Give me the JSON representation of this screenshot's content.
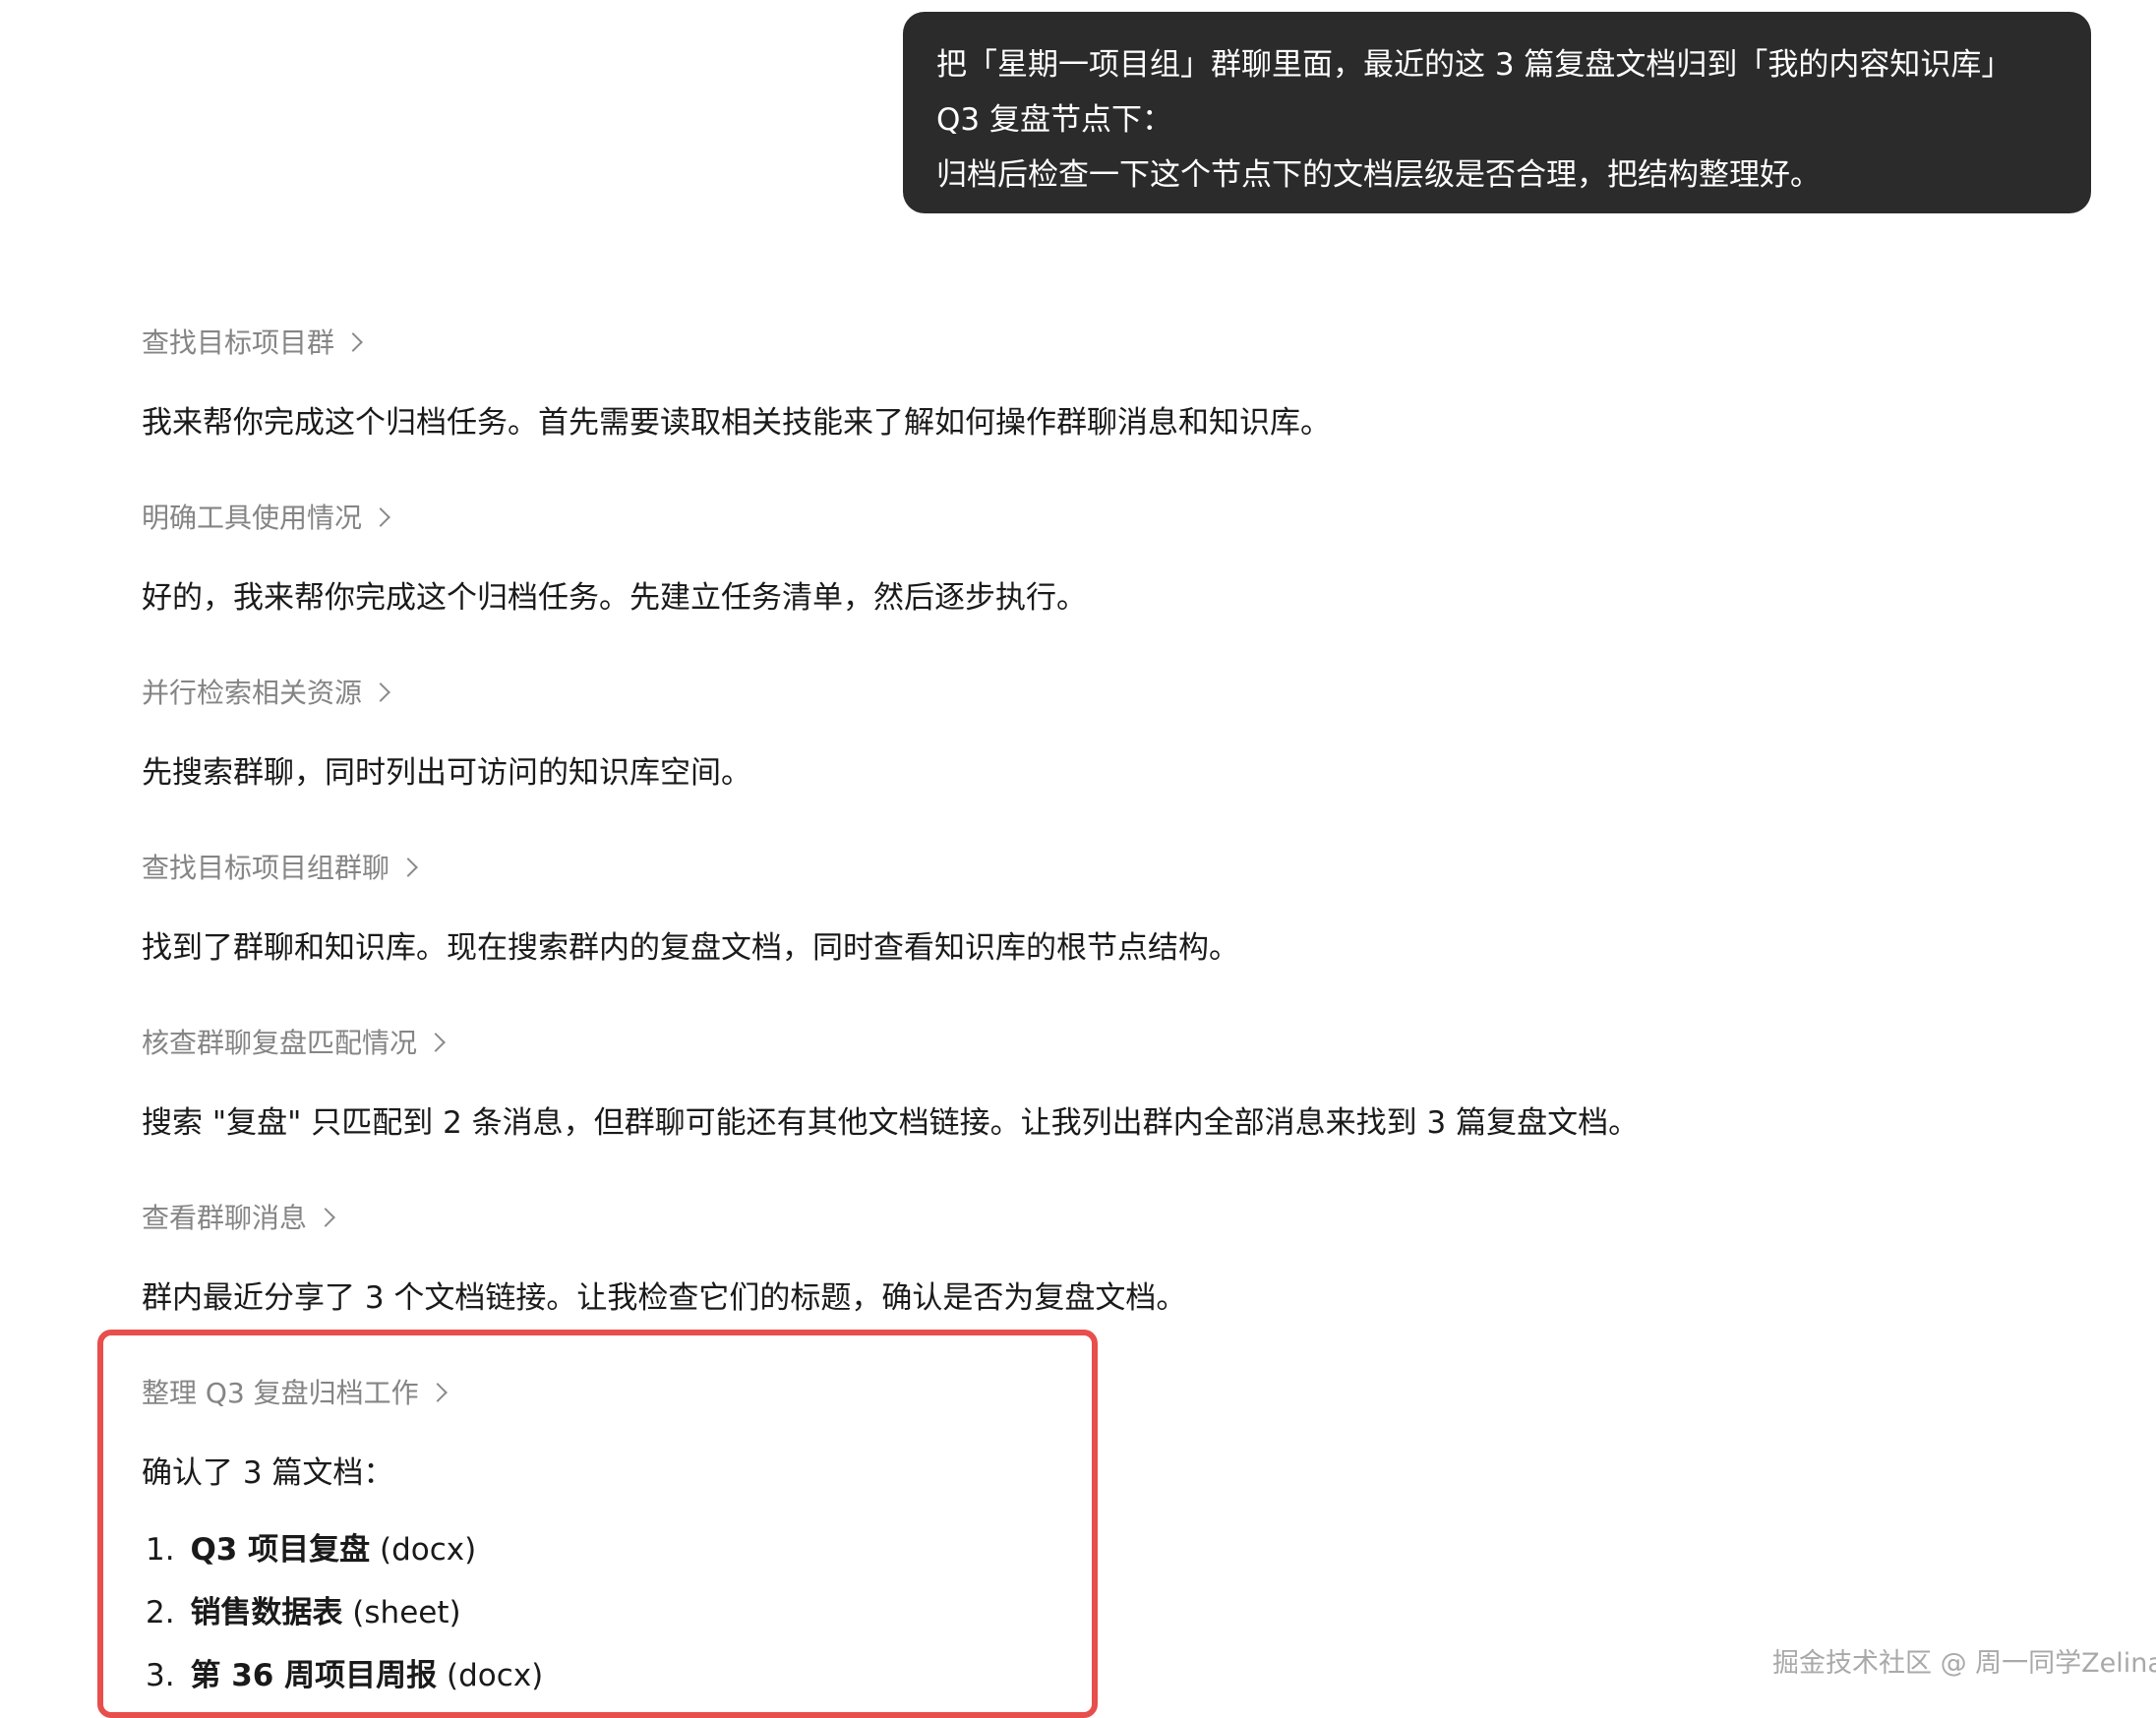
{
  "user_message": {
    "lines": [
      "把「星期一项目组」群聊里面，最近的这 3 篇复盘文档归到「我的内容知识库」",
      "Q3 复盘节点下：",
      "归档后检查一下这个节点下的文档层级是否合理，把结构整理好。"
    ]
  },
  "conversation": [
    {
      "step": "查找目标项目群",
      "reply": "我来帮你完成这个归档任务。首先需要读取相关技能来了解如何操作群聊消息和知识库。"
    },
    {
      "step": "明确工具使用情况",
      "reply": "好的，我来帮你完成这个归档任务。先建立任务清单，然后逐步执行。"
    },
    {
      "step": "并行检索相关资源",
      "reply": "先搜索群聊，同时列出可访问的知识库空间。"
    },
    {
      "step": "查找目标项目组群聊",
      "reply": "找到了群聊和知识库。现在搜索群内的复盘文档，同时查看知识库的根节点结构。"
    },
    {
      "step": "核查群聊复盘匹配情况",
      "reply": "搜索 \"复盘\" 只匹配到 2 条消息，但群聊可能还有其他文档链接。让我列出群内全部消息来找到 3 篇复盘文档。"
    },
    {
      "step": "查看群聊消息",
      "reply": "群内最近分享了 3 个文档链接。让我检查它们的标题，确认是否为复盘文档。"
    },
    {
      "step": "整理 Q3 复盘归档工作",
      "reply": "确认了 3 篇文档："
    }
  ],
  "documents": [
    {
      "num": "1.",
      "title": "Q3 项目复盘",
      "type": "(docx)"
    },
    {
      "num": "2.",
      "title": "销售数据表",
      "type": "(sheet)"
    },
    {
      "num": "3.",
      "title": "第 36 周项目周报",
      "type": "(docx)"
    }
  ],
  "watermark": "掘金技术社区 @ 周一同学Zelina",
  "colors": {
    "bubble_bg": "#2b2b2b",
    "highlight_border": "#e84e4b",
    "step_text": "#858585"
  }
}
